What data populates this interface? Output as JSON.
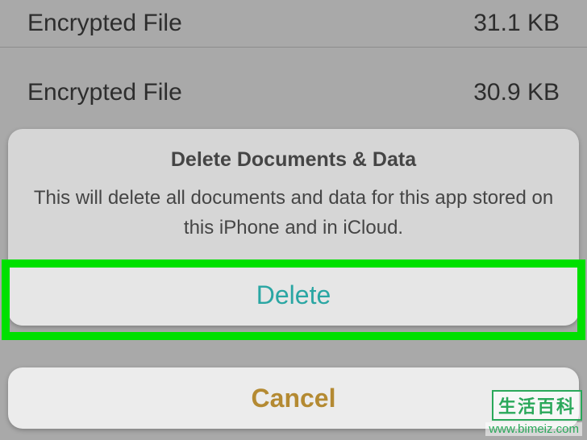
{
  "files": [
    {
      "name": "Encrypted File",
      "size": "31.1 KB"
    },
    {
      "name": "Encrypted File",
      "size": "30.9 KB"
    }
  ],
  "sheet": {
    "title": "Delete Documents & Data",
    "message": "This will delete all documents and data for this app stored on this iPhone and in iCloud.",
    "delete_label": "Delete",
    "cancel_label": "Cancel"
  },
  "watermark": {
    "badge": "生活百科",
    "url": "www.bimeiz.com"
  },
  "colors": {
    "highlight": "#00e000",
    "action_teal": "#2aa6a3",
    "cancel_amber": "#b48a32"
  }
}
